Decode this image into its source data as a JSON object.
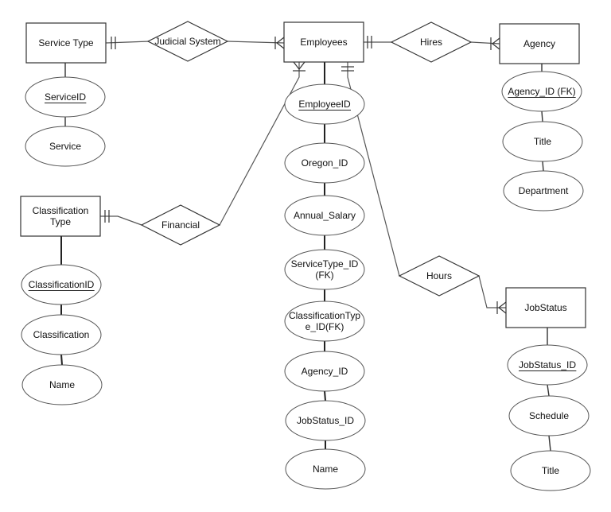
{
  "diagram": {
    "type": "entity-relationship",
    "entities": [
      {
        "id": "service_type",
        "label": [
          "Service Type"
        ]
      },
      {
        "id": "employees",
        "label": [
          "Employees"
        ]
      },
      {
        "id": "agency",
        "label": [
          "Agency"
        ]
      },
      {
        "id": "classification_type",
        "label": [
          "Classification",
          "Type"
        ]
      },
      {
        "id": "job_status",
        "label": [
          "JobStatus"
        ]
      }
    ],
    "relationships": [
      {
        "id": "judicial_system",
        "label": "Judicial System",
        "from": "service_type",
        "from_card": "one-and-only-one",
        "to": "employees",
        "to_card": "one-or-many"
      },
      {
        "id": "hires",
        "label": "Hires",
        "from": "employees",
        "from_card": "one-and-only-one",
        "to": "agency",
        "to_card": "one-or-many"
      },
      {
        "id": "financial",
        "label": "Financial",
        "from": "classification_type",
        "from_card": "one-and-only-one",
        "to": "employees",
        "to_card": "one-or-many"
      },
      {
        "id": "hours",
        "label": "Hours",
        "from": "employees",
        "from_card": "one-and-only-one",
        "to": "job_status",
        "to_card": "one-or-many"
      }
    ],
    "attributes": {
      "service_type": [
        {
          "label": [
            "ServiceID"
          ],
          "key": true
        },
        {
          "label": [
            "Service"
          ],
          "key": false
        }
      ],
      "employees": [
        {
          "label": [
            "EmployeeID"
          ],
          "key": true
        },
        {
          "label": [
            "Oregon_ID"
          ],
          "key": false
        },
        {
          "label": [
            "Annual_Salary"
          ],
          "key": false
        },
        {
          "label": [
            "ServiceType_ID",
            "(FK)"
          ],
          "key": false
        },
        {
          "label": [
            "ClassificationTyp",
            "e_ID(FK)"
          ],
          "key": false
        },
        {
          "label": [
            "Agency_ID"
          ],
          "key": false
        },
        {
          "label": [
            "JobStatus_ID"
          ],
          "key": false
        },
        {
          "label": [
            "Name"
          ],
          "key": false
        }
      ],
      "agency": [
        {
          "label": [
            "Agency_ID (FK)"
          ],
          "key": true
        },
        {
          "label": [
            "Title"
          ],
          "key": false
        },
        {
          "label": [
            "Department"
          ],
          "key": false
        }
      ],
      "classification_type": [
        {
          "label": [
            "ClassificationID"
          ],
          "key": true
        },
        {
          "label": [
            "Classification"
          ],
          "key": false
        },
        {
          "label": [
            "Name"
          ],
          "key": false
        }
      ],
      "job_status": [
        {
          "label": [
            "JobStatus_ID"
          ],
          "key": true
        },
        {
          "label": [
            "Schedule"
          ],
          "key": false
        },
        {
          "label": [
            "Title"
          ],
          "key": false
        }
      ]
    }
  }
}
